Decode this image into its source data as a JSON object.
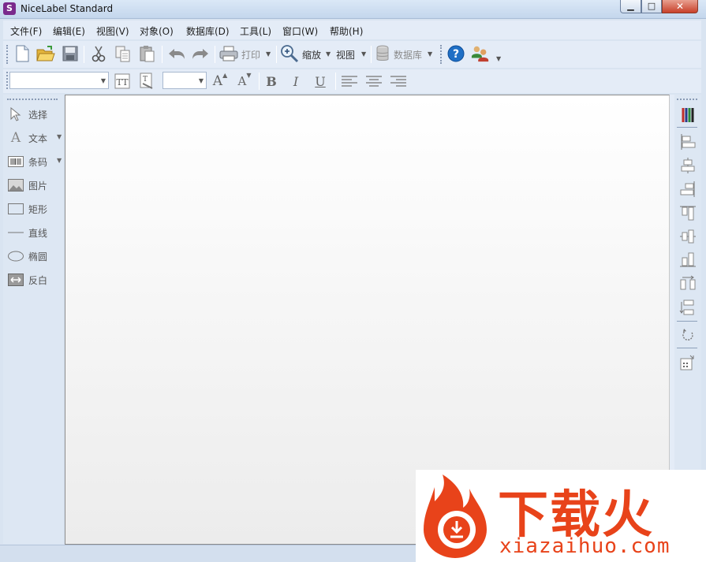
{
  "window": {
    "title": "NiceLabel Standard",
    "icon_letter": "S",
    "minimize_glyph": "▁",
    "maximize_glyph": "□",
    "close_glyph": "✕"
  },
  "menu": {
    "items": [
      {
        "label": "文件(F)"
      },
      {
        "label": "编辑(E)"
      },
      {
        "label": "视图(V)"
      },
      {
        "label": "对象(O)"
      },
      {
        "label": "数据库(D)"
      },
      {
        "label": "工具(L)"
      },
      {
        "label": "窗口(W)"
      },
      {
        "label": "帮助(H)"
      }
    ]
  },
  "toolbar": {
    "print_label": "打印",
    "zoom_label": "缩放",
    "view_label": "视图",
    "database_label": "数据库",
    "icons": [
      "new-file-icon",
      "open-folder-icon",
      "save-icon",
      "cut-icon",
      "copy-icon",
      "paste-icon",
      "undo-icon",
      "redo-icon",
      "printer-icon",
      "zoom-icon",
      "database-icon",
      "help-icon",
      "users-icon"
    ]
  },
  "format_toolbar": {
    "font_value": "",
    "size_value": "",
    "bold_glyph": "B",
    "italic_glyph": "I",
    "underline_glyph": "U",
    "grow_glyph": "A",
    "shrink_glyph": "A"
  },
  "tools": [
    {
      "label": "选择",
      "icon": "pointer-icon",
      "has_dropdown": false
    },
    {
      "label": "文本",
      "icon": "text-icon",
      "has_dropdown": true
    },
    {
      "label": "条码",
      "icon": "barcode-icon",
      "has_dropdown": true
    },
    {
      "label": "图片",
      "icon": "picture-icon",
      "has_dropdown": false
    },
    {
      "label": "矩形",
      "icon": "rectangle-icon",
      "has_dropdown": false
    },
    {
      "label": "直线",
      "icon": "line-icon",
      "has_dropdown": false
    },
    {
      "label": "椭圆",
      "icon": "ellipse-icon",
      "has_dropdown": false
    },
    {
      "label": "反白",
      "icon": "inverse-icon",
      "has_dropdown": false
    }
  ],
  "watermark": {
    "text": "下载火",
    "url": "xiazaihuo.com"
  },
  "colors": {
    "chrome": "#d9e4f1",
    "toolbar": "#e4ecf7",
    "watermark": "#e8431a",
    "help_blue": "#1f6fc5"
  }
}
